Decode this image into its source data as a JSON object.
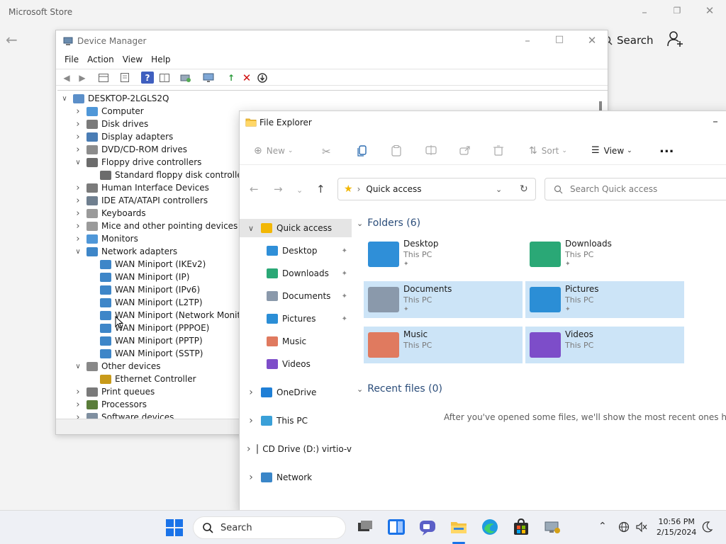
{
  "store": {
    "title": "Microsoft Store",
    "search_label": "Search"
  },
  "device_manager": {
    "title": "Device Manager",
    "menu": [
      "File",
      "Action",
      "View",
      "Help"
    ],
    "tree": [
      {
        "label": "DESKTOP-2LGLS2Q",
        "level": 0,
        "state": "expanded",
        "icon": "computer-icon"
      },
      {
        "label": "Computer",
        "level": 1,
        "state": "collapsed",
        "icon": "monitor-icon"
      },
      {
        "label": "Disk drives",
        "level": 1,
        "state": "collapsed",
        "icon": "disk-icon"
      },
      {
        "label": "Display adapters",
        "level": 1,
        "state": "collapsed",
        "icon": "display-adapter-icon"
      },
      {
        "label": "DVD/CD-ROM drives",
        "level": 1,
        "state": "collapsed",
        "icon": "dvd-icon"
      },
      {
        "label": "Floppy drive controllers",
        "level": 1,
        "state": "expanded",
        "icon": "floppy-icon"
      },
      {
        "label": "Standard floppy disk controller",
        "level": 2,
        "state": "leaf",
        "icon": "floppy-icon"
      },
      {
        "label": "Human Interface Devices",
        "level": 1,
        "state": "collapsed",
        "icon": "hid-icon"
      },
      {
        "label": "IDE ATA/ATAPI controllers",
        "level": 1,
        "state": "collapsed",
        "icon": "ide-icon"
      },
      {
        "label": "Keyboards",
        "level": 1,
        "state": "collapsed",
        "icon": "keyboard-icon"
      },
      {
        "label": "Mice and other pointing devices",
        "level": 1,
        "state": "collapsed",
        "icon": "mouse-icon"
      },
      {
        "label": "Monitors",
        "level": 1,
        "state": "collapsed",
        "icon": "monitor-icon"
      },
      {
        "label": "Network adapters",
        "level": 1,
        "state": "expanded",
        "icon": "network-adapter-icon"
      },
      {
        "label": "WAN Miniport (IKEv2)",
        "level": 2,
        "state": "leaf",
        "icon": "network-adapter-icon"
      },
      {
        "label": "WAN Miniport (IP)",
        "level": 2,
        "state": "leaf",
        "icon": "network-adapter-icon"
      },
      {
        "label": "WAN Miniport (IPv6)",
        "level": 2,
        "state": "leaf",
        "icon": "network-adapter-icon"
      },
      {
        "label": "WAN Miniport (L2TP)",
        "level": 2,
        "state": "leaf",
        "icon": "network-adapter-icon"
      },
      {
        "label": "WAN Miniport (Network Monitor)",
        "level": 2,
        "state": "leaf",
        "icon": "network-adapter-icon"
      },
      {
        "label": "WAN Miniport (PPPOE)",
        "level": 2,
        "state": "leaf",
        "icon": "network-adapter-icon"
      },
      {
        "label": "WAN Miniport (PPTP)",
        "level": 2,
        "state": "leaf",
        "icon": "network-adapter-icon"
      },
      {
        "label": "WAN Miniport (SSTP)",
        "level": 2,
        "state": "leaf",
        "icon": "network-adapter-icon"
      },
      {
        "label": "Other devices",
        "level": 1,
        "state": "expanded",
        "icon": "unknown-device-icon"
      },
      {
        "label": "Ethernet Controller",
        "level": 2,
        "state": "leaf",
        "icon": "warning-device-icon"
      },
      {
        "label": "Print queues",
        "level": 1,
        "state": "collapsed",
        "icon": "printer-icon"
      },
      {
        "label": "Processors",
        "level": 1,
        "state": "collapsed",
        "icon": "processor-icon"
      },
      {
        "label": "Software devices",
        "level": 1,
        "state": "collapsed",
        "icon": "software-device-icon"
      }
    ]
  },
  "file_explorer": {
    "title": "File Explorer",
    "commands": {
      "new": "New",
      "sort": "Sort",
      "view": "View",
      "more": "..."
    },
    "address": "Quick access",
    "search_placeholder": "Search Quick access",
    "nav": [
      {
        "label": "Quick access",
        "level": 0,
        "chevron": "expanded",
        "selected": true,
        "pinned": false,
        "icon": "star-icon"
      },
      {
        "label": "Desktop",
        "level": 1,
        "chevron": "none",
        "selected": false,
        "pinned": true,
        "icon": "desktop-icon"
      },
      {
        "label": "Downloads",
        "level": 1,
        "chevron": "none",
        "selected": false,
        "pinned": true,
        "icon": "downloads-icon"
      },
      {
        "label": "Documents",
        "level": 1,
        "chevron": "none",
        "selected": false,
        "pinned": true,
        "icon": "documents-icon"
      },
      {
        "label": "Pictures",
        "level": 1,
        "chevron": "none",
        "selected": false,
        "pinned": true,
        "icon": "pictures-icon"
      },
      {
        "label": "Music",
        "level": 1,
        "chevron": "none",
        "selected": false,
        "pinned": false,
        "icon": "music-icon"
      },
      {
        "label": "Videos",
        "level": 1,
        "chevron": "none",
        "selected": false,
        "pinned": false,
        "icon": "videos-icon"
      },
      {
        "label": "OneDrive",
        "level": 0,
        "chevron": "collapsed",
        "selected": false,
        "pinned": false,
        "icon": "cloud-icon"
      },
      {
        "label": "This PC",
        "level": 0,
        "chevron": "collapsed",
        "selected": false,
        "pinned": false,
        "icon": "pc-icon"
      },
      {
        "label": "CD Drive (D:) virtio-v",
        "level": 0,
        "chevron": "collapsed",
        "selected": false,
        "pinned": false,
        "icon": "cd-drive-icon"
      },
      {
        "label": "Network",
        "level": 0,
        "chevron": "collapsed",
        "selected": false,
        "pinned": false,
        "icon": "network-icon"
      }
    ],
    "folders_heading": "Folders (6)",
    "folders": [
      {
        "name": "Desktop",
        "location": "This PC",
        "pinned": true,
        "selected": false,
        "icon": "desktop-folder-icon",
        "color": "#2f8fd8"
      },
      {
        "name": "Downloads",
        "location": "This PC",
        "pinned": true,
        "selected": false,
        "icon": "downloads-folder-icon",
        "color": "#2aa876"
      },
      {
        "name": "Documents",
        "location": "This PC",
        "pinned": true,
        "selected": true,
        "icon": "documents-folder-icon",
        "color": "#8a99ab"
      },
      {
        "name": "Pictures",
        "location": "This PC",
        "pinned": true,
        "selected": true,
        "icon": "pictures-folder-icon",
        "color": "#2b8ed6"
      },
      {
        "name": "Music",
        "location": "This PC",
        "pinned": false,
        "selected": true,
        "icon": "music-folder-icon",
        "color": "#e07a5f"
      },
      {
        "name": "Videos",
        "location": "This PC",
        "pinned": false,
        "selected": true,
        "icon": "videos-folder-icon",
        "color": "#7d4dc9"
      }
    ],
    "recent_heading": "Recent files (0)",
    "recent_empty": "After you've opened some files, we'll show the most recent ones here."
  },
  "taskbar": {
    "search_label": "Search",
    "time": "10:56 PM",
    "date": "2/15/2024"
  }
}
